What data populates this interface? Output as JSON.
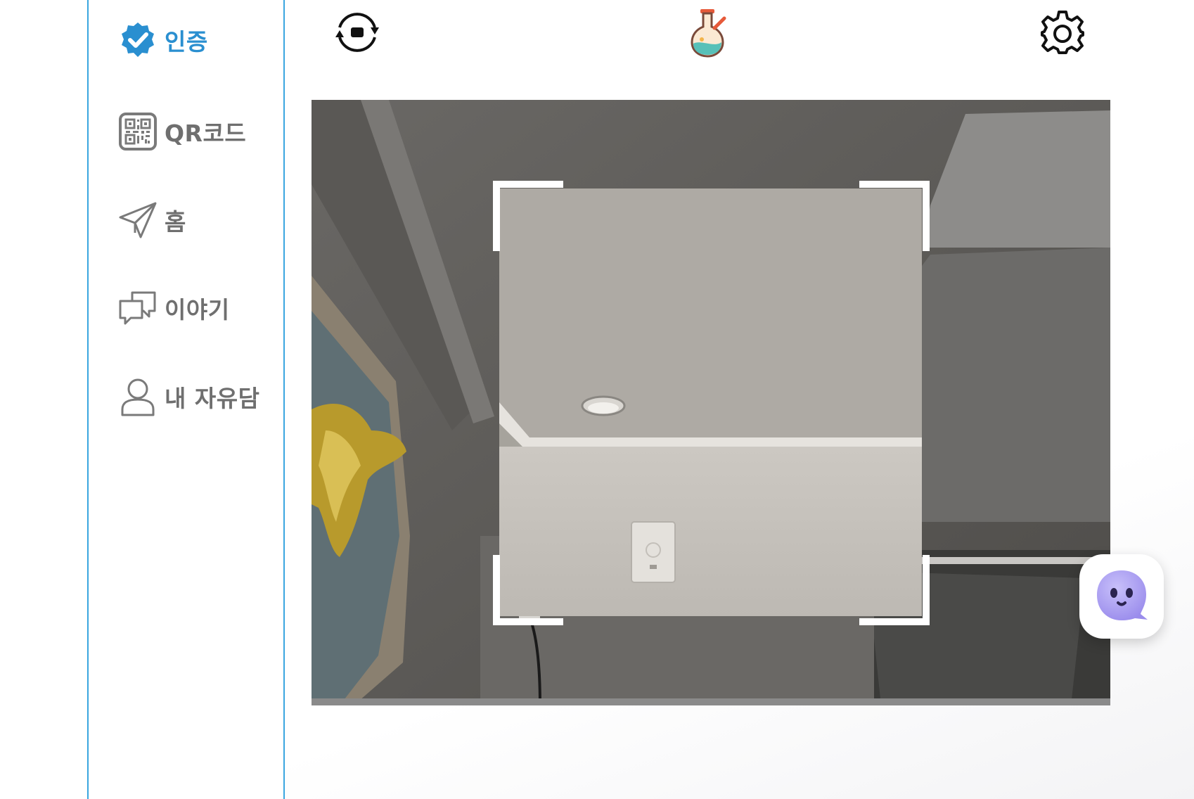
{
  "sidebar": {
    "items": [
      {
        "label": "인증",
        "icon": "verified-badge-icon",
        "active": true
      },
      {
        "label": "QR코드",
        "icon": "qr-code-icon",
        "active": false
      },
      {
        "label": "홈",
        "icon": "paper-plane-icon",
        "active": false
      },
      {
        "label": "이야기",
        "icon": "chat-bubbles-icon",
        "active": false
      },
      {
        "label": "내 자유담",
        "icon": "user-icon",
        "active": false
      }
    ]
  },
  "toolbar": {
    "switch_camera_icon": "switch-camera-icon",
    "lab_icon": "flask-icon",
    "settings_icon": "gear-icon"
  },
  "camera": {
    "scan_frame": "qr-scan-frame"
  },
  "chatbot": {
    "icon": "ghost-chatbot-icon"
  },
  "colors": {
    "accent": "#2a8fd0",
    "sidebar_border": "#3aa6e0",
    "label_gray": "#6f6f6f",
    "chatbot_purple": "#a99cf0"
  }
}
